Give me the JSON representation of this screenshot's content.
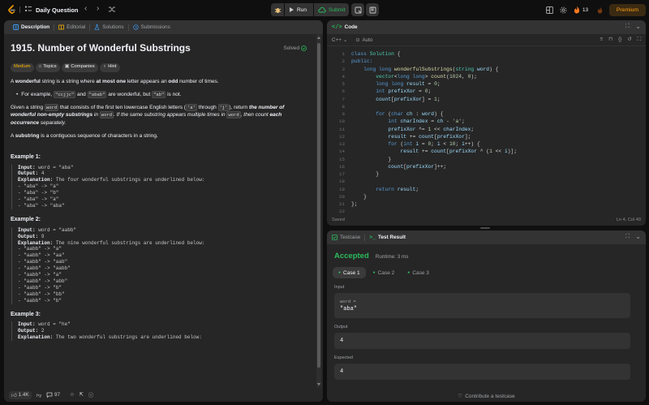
{
  "colors": {
    "accent_green": "#2cbb5d",
    "accent_orange": "#ffa116",
    "bg": "#0f0f0f",
    "panel": "#262626",
    "panel_header": "#333333"
  },
  "topbar": {
    "title": "Daily Question",
    "run_label": "Run",
    "submit_label": "Submit",
    "streak": "13",
    "premium_label": "Premium"
  },
  "description": {
    "tabs": [
      "Description",
      "Editorial",
      "Solutions",
      "Submissions"
    ],
    "title": "1915. Number of Wonderful Substrings",
    "solved_label": "Solved",
    "chips": [
      "Medium",
      "Topics",
      "Companies",
      "Hint"
    ],
    "p1": {
      "a": "A ",
      "b": "wonderful",
      "c": " string is a string where ",
      "d": "at most one",
      "e": " letter appears an ",
      "f": "odd",
      "g": " number of times."
    },
    "bullet": {
      "a": "For example, ",
      "c1": "\"ccjjc\"",
      "b": " and ",
      "c2": "\"abab\"",
      "c": " are wonderful, but ",
      "c3": "\"ab\"",
      "d": " is not."
    },
    "p2": {
      "a": "Given a string ",
      "c1": "word",
      "b": " that consists of the first ten lowercase English letters (",
      "c2": "'a'",
      "c": " through ",
      "c3": "'j'",
      "d": "), return ",
      "e": "the number of wonderful non-empty substrings",
      "f": " in ",
      "c4": "word",
      "g": ". If the same substring appears multiple times in ",
      "c5": "word",
      "h": ", then count ",
      "i": "each occurrence",
      "j": " separately."
    },
    "p3": {
      "a": "A ",
      "b": "substring",
      "c": " is a contiguous sequence of characters in a string."
    },
    "examples": [
      {
        "title": "Example 1:",
        "input": " word = \"aba\"",
        "output": " 4",
        "explanation": " The four wonderful substrings are underlined below:",
        "items": [
          "- \"aba\" -> \"a\"",
          "- \"aba\" -> \"b\"",
          "- \"aba\" -> \"a\"",
          "- \"aba\" -> \"aba\""
        ]
      },
      {
        "title": "Example 2:",
        "input": " word = \"aabb\"",
        "output": " 9",
        "explanation": " The nine wonderful substrings are underlined below:",
        "items": [
          "- \"aabb\" -> \"a\"",
          "- \"aabb\" -> \"aa\"",
          "- \"aabb\" -> \"aab\"",
          "- \"aabb\" -> \"aabb\"",
          "- \"aabb\" -> \"a\"",
          "- \"aabb\" -> \"abb\"",
          "- \"aabb\" -> \"b\"",
          "- \"aabb\" -> \"bb\"",
          "- \"aabb\" -> \"b\""
        ]
      },
      {
        "title": "Example 3:",
        "input": " word = \"he\"",
        "output": " 2",
        "explanation": " The two wonderful substrings are underlined below:",
        "items": []
      }
    ],
    "labels": {
      "input": "Input:",
      "output": "Output:",
      "explanation": "Explanation:"
    },
    "footer": {
      "likes": "1.4K",
      "comments": "97"
    }
  },
  "code": {
    "tab": "Code",
    "language": "C++",
    "auto_label": "Auto",
    "status": "Saved",
    "cursor": "Ln 4, Col 40",
    "lines": [
      [
        {
          "t": "class ",
          "c": "kw"
        },
        {
          "t": "Solution ",
          "c": "ty"
        },
        {
          "t": "{",
          "c": "cm"
        }
      ],
      [
        {
          "t": "public:",
          "c": "kw"
        }
      ],
      [
        {
          "t": "    long long ",
          "c": "kw"
        },
        {
          "t": "wonderfulSubstrings",
          "c": "fn"
        },
        {
          "t": "(",
          "c": "cm"
        },
        {
          "t": "string ",
          "c": "ty"
        },
        {
          "t": "word",
          "c": "vr"
        },
        {
          "t": ") {",
          "c": "cm"
        }
      ],
      [
        {
          "t": "        vector",
          "c": "ty"
        },
        {
          "t": "<",
          "c": "cm"
        },
        {
          "t": "long long",
          "c": "kw"
        },
        {
          "t": "> ",
          "c": "cm"
        },
        {
          "t": "count",
          "c": "fn"
        },
        {
          "t": "(",
          "c": "cm"
        },
        {
          "t": "1024",
          "c": "nm"
        },
        {
          "t": ", ",
          "c": "cm"
        },
        {
          "t": "0",
          "c": "nm"
        },
        {
          "t": ");",
          "c": "cm"
        }
      ],
      [
        {
          "t": "        long long ",
          "c": "kw"
        },
        {
          "t": "result",
          "c": "vr"
        },
        {
          "t": " = ",
          "c": "cm"
        },
        {
          "t": "0",
          "c": "nm"
        },
        {
          "t": ";",
          "c": "cm"
        }
      ],
      [
        {
          "t": "        int ",
          "c": "kw"
        },
        {
          "t": "prefixXor",
          "c": "vr"
        },
        {
          "t": " = ",
          "c": "cm"
        },
        {
          "t": "0",
          "c": "nm"
        },
        {
          "t": ";",
          "c": "cm"
        }
      ],
      [
        {
          "t": "        count",
          "c": "vr"
        },
        {
          "t": "[",
          "c": "cm"
        },
        {
          "t": "prefixXor",
          "c": "vr"
        },
        {
          "t": "] = ",
          "c": "cm"
        },
        {
          "t": "1",
          "c": "nm"
        },
        {
          "t": ";",
          "c": "cm"
        }
      ],
      [],
      [
        {
          "t": "        for ",
          "c": "kw"
        },
        {
          "t": "(",
          "c": "cm"
        },
        {
          "t": "char ",
          "c": "kw"
        },
        {
          "t": "ch",
          "c": "vr"
        },
        {
          "t": " : ",
          "c": "cm"
        },
        {
          "t": "word",
          "c": "vr"
        },
        {
          "t": ") {",
          "c": "cm"
        }
      ],
      [
        {
          "t": "            int ",
          "c": "kw"
        },
        {
          "t": "charIndex",
          "c": "vr"
        },
        {
          "t": " = ",
          "c": "cm"
        },
        {
          "t": "ch",
          "c": "vr"
        },
        {
          "t": " - ",
          "c": "cm"
        },
        {
          "t": "'a'",
          "c": "nm"
        },
        {
          "t": ";",
          "c": "cm"
        }
      ],
      [
        {
          "t": "            prefixXor",
          "c": "vr"
        },
        {
          "t": " ^= ",
          "c": "cm"
        },
        {
          "t": "1",
          "c": "nm"
        },
        {
          "t": " << ",
          "c": "cm"
        },
        {
          "t": "charIndex",
          "c": "vr"
        },
        {
          "t": ";",
          "c": "cm"
        }
      ],
      [
        {
          "t": "            result",
          "c": "vr"
        },
        {
          "t": " += ",
          "c": "cm"
        },
        {
          "t": "count",
          "c": "vr"
        },
        {
          "t": "[",
          "c": "cm"
        },
        {
          "t": "prefixXor",
          "c": "vr"
        },
        {
          "t": "];",
          "c": "cm"
        }
      ],
      [
        {
          "t": "            for ",
          "c": "kw"
        },
        {
          "t": "(",
          "c": "cm"
        },
        {
          "t": "int ",
          "c": "kw"
        },
        {
          "t": "i",
          "c": "vr"
        },
        {
          "t": " = ",
          "c": "cm"
        },
        {
          "t": "0",
          "c": "nm"
        },
        {
          "t": "; ",
          "c": "cm"
        },
        {
          "t": "i",
          "c": "vr"
        },
        {
          "t": " < ",
          "c": "cm"
        },
        {
          "t": "10",
          "c": "nm"
        },
        {
          "t": "; ",
          "c": "cm"
        },
        {
          "t": "i",
          "c": "vr"
        },
        {
          "t": "++) {",
          "c": "cm"
        }
      ],
      [
        {
          "t": "                result",
          "c": "vr"
        },
        {
          "t": " += ",
          "c": "cm"
        },
        {
          "t": "count",
          "c": "vr"
        },
        {
          "t": "[",
          "c": "cm"
        },
        {
          "t": "prefixXor",
          "c": "vr"
        },
        {
          "t": " ^ (",
          "c": "cm"
        },
        {
          "t": "1",
          "c": "nm"
        },
        {
          "t": " << ",
          "c": "cm"
        },
        {
          "t": "i",
          "c": "vr"
        },
        {
          "t": ")];",
          "c": "cm"
        }
      ],
      [
        {
          "t": "            }",
          "c": "cm"
        }
      ],
      [
        {
          "t": "            count",
          "c": "vr"
        },
        {
          "t": "[",
          "c": "cm"
        },
        {
          "t": "prefixXor",
          "c": "vr"
        },
        {
          "t": "]++;",
          "c": "cm"
        }
      ],
      [
        {
          "t": "        }",
          "c": "cm"
        }
      ],
      [],
      [
        {
          "t": "        return ",
          "c": "kw"
        },
        {
          "t": "result",
          "c": "vr"
        },
        {
          "t": ";",
          "c": "cm"
        }
      ],
      [
        {
          "t": "    }",
          "c": "cm"
        }
      ],
      [
        {
          "t": "};",
          "c": "cm"
        }
      ],
      []
    ]
  },
  "result": {
    "tabs": [
      "Testcase",
      "Test Result"
    ],
    "status": "Accepted",
    "runtime": "Runtime: 3 ms",
    "cases": [
      "Case 1",
      "Case 2",
      "Case 3"
    ],
    "input_label": "Input",
    "var_label": "word =",
    "var_value": "\"aba\"",
    "output_label": "Output",
    "output_value": "4",
    "expected_label": "Expected",
    "expected_value": "4",
    "contribute_label": "Contribute a testcase"
  }
}
